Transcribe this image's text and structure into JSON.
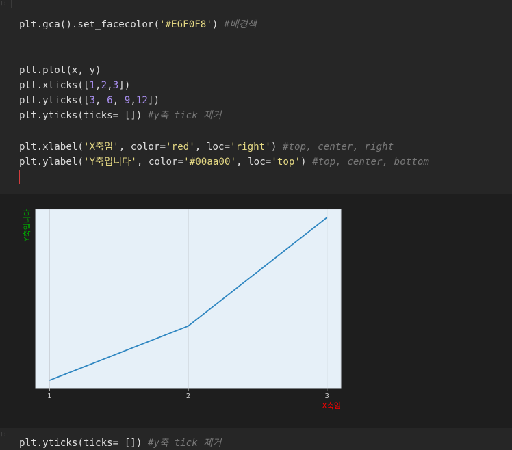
{
  "code_cell": {
    "prompt": "]:",
    "lines": [
      {
        "parts": [
          {
            "t": "plt.gca().set_facecolor(",
            "c": "plain"
          },
          {
            "t": "'#E6F0F8'",
            "c": "str"
          },
          {
            "t": ") ",
            "c": "plain"
          },
          {
            "t": "#배경색",
            "c": "com"
          }
        ]
      },
      {
        "parts": [
          {
            "t": "plt.plot(x, y)",
            "c": "plain"
          }
        ]
      },
      {
        "parts": [
          {
            "t": "plt.xticks([",
            "c": "plain"
          },
          {
            "t": "1",
            "c": "num"
          },
          {
            "t": ",",
            "c": "plain"
          },
          {
            "t": "2",
            "c": "num"
          },
          {
            "t": ",",
            "c": "plain"
          },
          {
            "t": "3",
            "c": "num"
          },
          {
            "t": "])",
            "c": "plain"
          }
        ]
      },
      {
        "parts": [
          {
            "t": "plt.yticks([",
            "c": "plain"
          },
          {
            "t": "3",
            "c": "num"
          },
          {
            "t": ", ",
            "c": "plain"
          },
          {
            "t": "6",
            "c": "num"
          },
          {
            "t": ", ",
            "c": "plain"
          },
          {
            "t": "9",
            "c": "num"
          },
          {
            "t": ",",
            "c": "plain"
          },
          {
            "t": "12",
            "c": "num"
          },
          {
            "t": "])",
            "c": "plain"
          }
        ]
      },
      {
        "parts": [
          {
            "t": "plt.yticks(ticks= []) ",
            "c": "plain"
          },
          {
            "t": "#y축 tick 제거",
            "c": "com"
          }
        ]
      },
      {
        "parts": [
          {
            "t": "plt.xlabel(",
            "c": "plain"
          },
          {
            "t": "'X축임'",
            "c": "str"
          },
          {
            "t": ", color=",
            "c": "plain"
          },
          {
            "t": "'red'",
            "c": "str"
          },
          {
            "t": ", loc=",
            "c": "plain"
          },
          {
            "t": "'right'",
            "c": "str"
          },
          {
            "t": ") ",
            "c": "plain"
          },
          {
            "t": "#top, center, right",
            "c": "com"
          }
        ]
      },
      {
        "parts": [
          {
            "t": "plt.ylabel(",
            "c": "plain"
          },
          {
            "t": "'Y축입니다'",
            "c": "str"
          },
          {
            "t": ", color=",
            "c": "plain"
          },
          {
            "t": "'#00aa00'",
            "c": "str"
          },
          {
            "t": ", loc=",
            "c": "plain"
          },
          {
            "t": "'top'",
            "c": "str"
          },
          {
            "t": ") ",
            "c": "plain"
          },
          {
            "t": "#top, center, bottom",
            "c": "com"
          }
        ]
      }
    ]
  },
  "chart_data": {
    "type": "line",
    "x": [
      1,
      2,
      3
    ],
    "series": [
      {
        "values": [
          1.0,
          2.0,
          4.0
        ],
        "color": "#2e86c1"
      }
    ],
    "xticks": [
      "1",
      "2",
      "3"
    ],
    "yticks": [],
    "xlim": [
      0.9,
      3.1
    ],
    "ylim": [
      0.85,
      4.15
    ],
    "xlabel": "X축임",
    "xlabel_color": "#ff0000",
    "xlabel_loc": "right",
    "ylabel": "Y축입니다",
    "ylabel_color": "#00aa00",
    "ylabel_loc": "top",
    "facecolor": "#E6F0F8",
    "grid": "x"
  },
  "next_cell": {
    "prompt": "]:",
    "parts": [
      {
        "t": "plt.yticks(ticks= []) ",
        "c": "plain"
      },
      {
        "t": "#y축 tick 제거",
        "c": "com"
      }
    ]
  }
}
